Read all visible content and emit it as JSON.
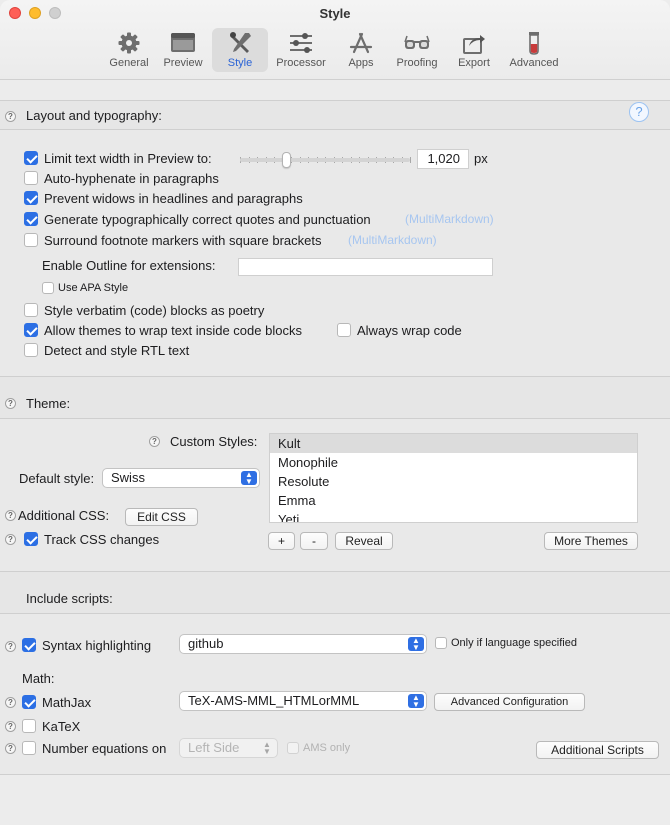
{
  "window": {
    "title": "Style"
  },
  "tabs": [
    {
      "label": "General",
      "icon": "gear-icon"
    },
    {
      "label": "Preview",
      "icon": "preview-window-icon"
    },
    {
      "label": "Style",
      "icon": "style-tools-icon",
      "active": true
    },
    {
      "label": "Processor",
      "icon": "sliders-icon"
    },
    {
      "label": "Apps",
      "icon": "apps-icon"
    },
    {
      "label": "Proofing",
      "icon": "glasses-icon"
    },
    {
      "label": "Export",
      "icon": "export-icon"
    },
    {
      "label": "Advanced",
      "icon": "flask-icon"
    }
  ],
  "layout": {
    "heading": "Layout and typography:",
    "help": "?",
    "limit_width_label": "Limit text width in Preview to:",
    "limit_width_value": "1,020",
    "limit_width_unit": "px",
    "limit_width_slider_fraction": 0.26,
    "auto_hyphenate": "Auto-hyphenate in paragraphs",
    "prevent_widows": "Prevent widows in headlines and paragraphs",
    "typographic_quotes": "Generate typographically correct quotes and punctuation",
    "typographic_quotes_note": "(MultiMarkdown)",
    "footnote_brackets": "Surround footnote markers with square brackets",
    "footnote_brackets_note": "(MultiMarkdown)",
    "outline_label": "Enable Outline for extensions:",
    "outline_value": "",
    "apa_style": "Use APA Style",
    "verbatim_poetry": "Style verbatim (code) blocks as poetry",
    "wrap_code_blocks": "Allow themes to wrap text inside code blocks",
    "always_wrap": "Always wrap code",
    "rtl_text": "Detect and style RTL text"
  },
  "theme": {
    "heading": "Theme:",
    "custom_styles_label": "Custom Styles:",
    "custom_styles": [
      "Kult",
      "Monophile",
      "Resolute",
      "Emma",
      "Yeti"
    ],
    "default_style_label": "Default style:",
    "default_style_value": "Swiss",
    "additional_css_label": "Additional CSS:",
    "edit_css": "Edit CSS",
    "track_css": "Track CSS changes",
    "add": "+",
    "remove": "-",
    "reveal": "Reveal",
    "more_themes": "More Themes"
  },
  "scripts": {
    "heading": "Include scripts:",
    "syntax_label": "Syntax highlighting",
    "syntax_value": "github",
    "only_if_language": "Only if language specified",
    "math_label": "Math:",
    "mathjax": "MathJax",
    "mathjax_value": "TeX-AMS-MML_HTMLorMML",
    "advanced_config": "Advanced Configuration",
    "katex": "KaTeX",
    "number_equations": "Number equations on",
    "number_equations_value": "Left Side",
    "ams_only": "AMS only",
    "additional_scripts": "Additional Scripts"
  },
  "colors": {
    "accent": "#2c6fe4",
    "note": "#a7c6f0"
  }
}
